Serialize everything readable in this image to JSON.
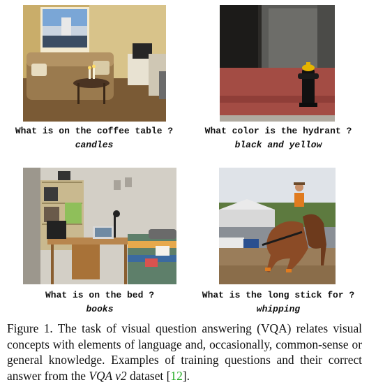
{
  "panels": [
    {
      "question": "What is on the coffee table ?",
      "answer": "candles",
      "image": "living-room-photo"
    },
    {
      "question": "What color is the hydrant ?",
      "answer": "black and yellow",
      "image": "hydrant-photo"
    },
    {
      "question": "What is on the bed ?",
      "answer": "books",
      "image": "bedroom-photo"
    },
    {
      "question": "What is the long stick for ?",
      "answer": "whipping",
      "image": "rodeo-photo"
    }
  ],
  "caption": {
    "label": "Figure 1.",
    "text_before": " The task of visual question answering (VQA) relates visual concepts with elements of language and, occasionally, common-sense or general knowledge. Examples of training questions and their correct answer from the ",
    "dataset": "VQA v2",
    "text_after": " dataset [",
    "citation": "12",
    "text_end": "]."
  }
}
